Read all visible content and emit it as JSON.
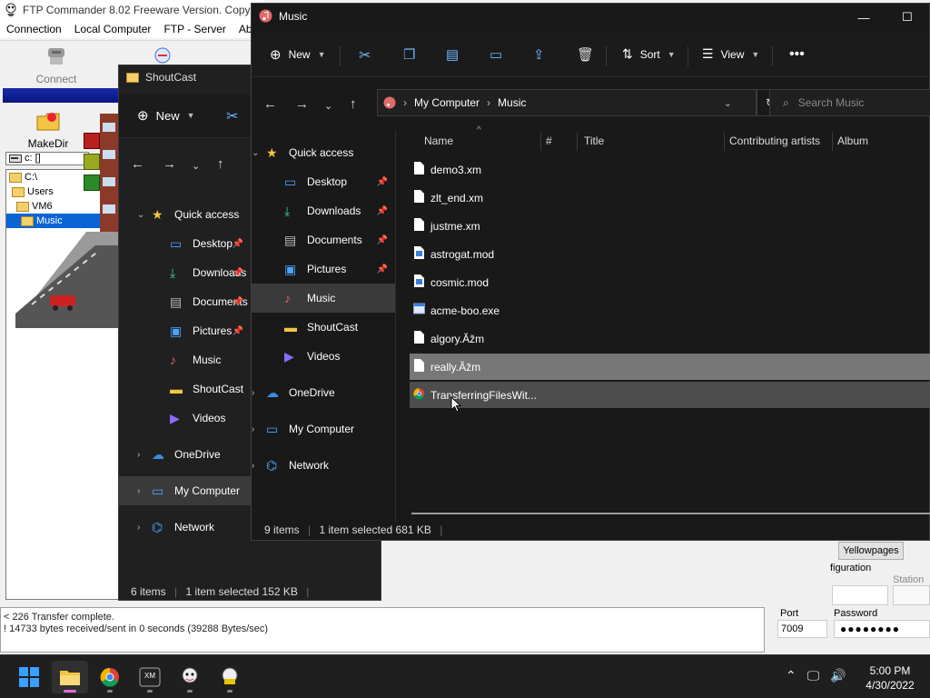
{
  "ftp": {
    "title": "FTP Commander 8.02  Freeware Version.  Copyri",
    "menu": [
      "Connection",
      "Local Computer",
      "FTP - Server",
      "Abo"
    ],
    "connect_label": "Connect",
    "makedir_label": "MakeDir",
    "drive": "c: []",
    "tree": [
      "C:\\",
      "Users",
      "VM6",
      "Music"
    ],
    "log": [
      "< 226 Transfer complete.",
      "! 14733 bytes received/sent in 0 seconds (39288 Bytes/sec)"
    ],
    "yellowpages": "Yellowpages",
    "configuration": "figuration",
    "station_id": "Station II",
    "port_label": "Port",
    "port_value": "7009",
    "password_label": "Password",
    "password_value": "●●●●●●●●"
  },
  "shoutcast": {
    "title": "ShoutCast",
    "new_label": "New",
    "nav": [
      {
        "label": "Quick access",
        "icon": "star-icon"
      },
      {
        "label": "Desktop",
        "icon": "desktop-icon"
      },
      {
        "label": "Downloads",
        "icon": "download-icon"
      },
      {
        "label": "Documents",
        "icon": "document-icon"
      },
      {
        "label": "Pictures",
        "icon": "picture-icon"
      },
      {
        "label": "Music",
        "icon": "music-icon"
      },
      {
        "label": "ShoutCast",
        "icon": "folder-icon"
      },
      {
        "label": "Videos",
        "icon": "video-icon"
      },
      {
        "label": "OneDrive",
        "icon": "cloud-icon"
      },
      {
        "label": "My Computer",
        "icon": "computer-icon"
      },
      {
        "label": "Network",
        "icon": "network-icon"
      }
    ],
    "status_items": "6 items",
    "status_selected": "1 item selected  152 KB"
  },
  "music": {
    "title": "Music",
    "toolbar": {
      "new": "New",
      "sort": "Sort",
      "view": "View"
    },
    "breadcrumb": [
      "My Computer",
      "Music"
    ],
    "search_placeholder": "Search Music",
    "nav": [
      {
        "label": "Quick access"
      },
      {
        "label": "Desktop"
      },
      {
        "label": "Downloads"
      },
      {
        "label": "Documents"
      },
      {
        "label": "Pictures"
      },
      {
        "label": "Music"
      },
      {
        "label": "ShoutCast"
      },
      {
        "label": "Videos"
      },
      {
        "label": "OneDrive"
      },
      {
        "label": "My Computer"
      },
      {
        "label": "Network"
      }
    ],
    "columns": [
      "Name",
      "#",
      "Title",
      "Contributing artists",
      "Album"
    ],
    "files": [
      {
        "name": "demo3.xm",
        "icon": "file-icon"
      },
      {
        "name": "zlt_end.xm",
        "icon": "file-icon"
      },
      {
        "name": "justme.xm",
        "icon": "file-icon"
      },
      {
        "name": "astrogat.mod",
        "icon": "module-icon"
      },
      {
        "name": "cosmic.mod",
        "icon": "module-icon"
      },
      {
        "name": "acme-boo.exe",
        "icon": "exe-icon"
      },
      {
        "name": "algory.Ăžm",
        "icon": "file-icon"
      },
      {
        "name": "really.Ăžm",
        "icon": "file-icon"
      },
      {
        "name": "TransferringFilesWit...",
        "icon": "chrome-icon"
      }
    ],
    "status_items": "9 items",
    "status_selected": "1 item selected  681 KB"
  },
  "taskbar": {
    "apps": [
      "start-icon",
      "file-explorer-icon",
      "chrome-icon",
      "xmplay-icon",
      "shoutcast-icon",
      "ftp-commander-icon"
    ],
    "time": "5:00 PM",
    "date": "4/30/2022"
  },
  "colors": {
    "selection": "#777777",
    "hover": "#4d4d4d",
    "ftp_tree_selection": "#0a64d6",
    "accent": "#e06ad8"
  }
}
